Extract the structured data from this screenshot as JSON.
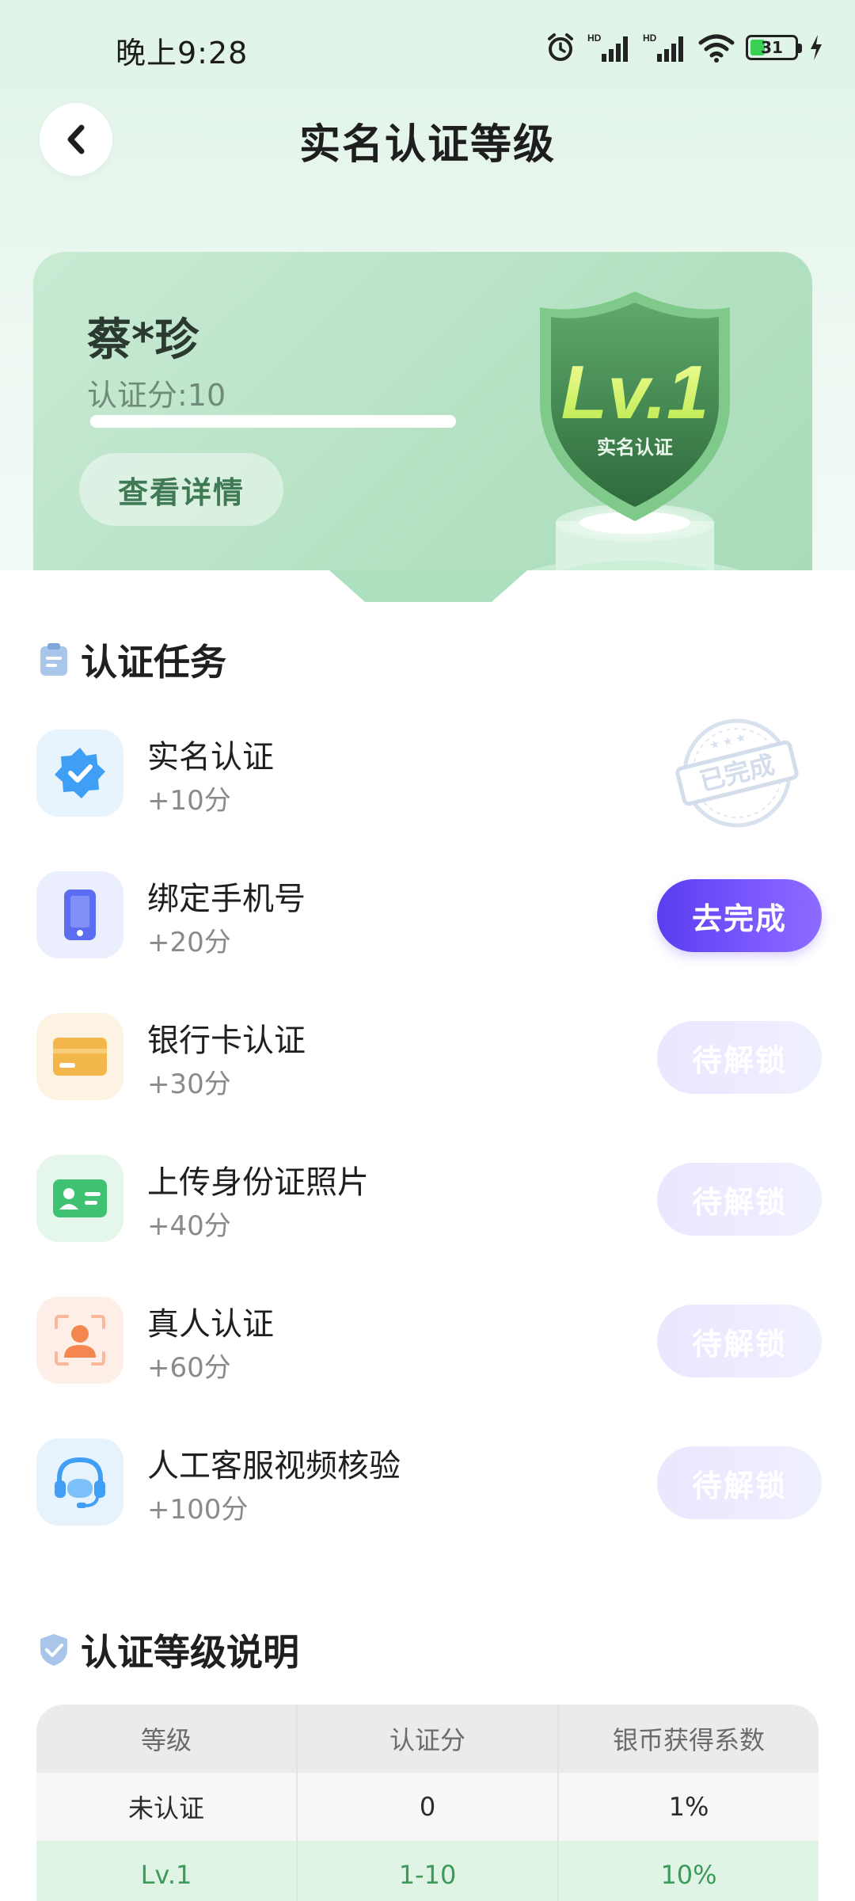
{
  "status_bar": {
    "time": "晚上9:28",
    "battery": "31"
  },
  "header": {
    "title": "实名认证等级"
  },
  "level_card": {
    "user_name": "蔡*珍",
    "score_text": "认证分:10",
    "progress": 1.0,
    "detail_button": "查看详情",
    "badge_level": "Lv.1",
    "badge_caption": "实名认证"
  },
  "tasks_section": {
    "title": "认证任务",
    "stamp_text": "已完成",
    "items": [
      {
        "name": "实名认证",
        "points": "+10分",
        "status": "completed",
        "button": ""
      },
      {
        "name": "绑定手机号",
        "points": "+20分",
        "status": "active",
        "button": "去完成"
      },
      {
        "name": "银行卡认证",
        "points": "+30分",
        "status": "locked",
        "button": "待解锁"
      },
      {
        "name": "上传身份证照片",
        "points": "+40分",
        "status": "locked",
        "button": "待解锁"
      },
      {
        "name": "真人认证",
        "points": "+60分",
        "status": "locked",
        "button": "待解锁"
      },
      {
        "name": "人工客服视频核验",
        "points": "+100分",
        "status": "locked",
        "button": "待解锁"
      }
    ]
  },
  "levels_section": {
    "title": "认证等级说明",
    "table": {
      "headers": [
        "等级",
        "认证分",
        "银币获得系数"
      ],
      "rows": [
        [
          "未认证",
          "0",
          "1%"
        ],
        [
          "Lv.1",
          "1-10",
          "10%"
        ]
      ]
    }
  },
  "colors": {
    "accent_purple": "#6a4cf7",
    "accent_green": "#3c9a5b",
    "card_green": "#b3e1c2"
  }
}
